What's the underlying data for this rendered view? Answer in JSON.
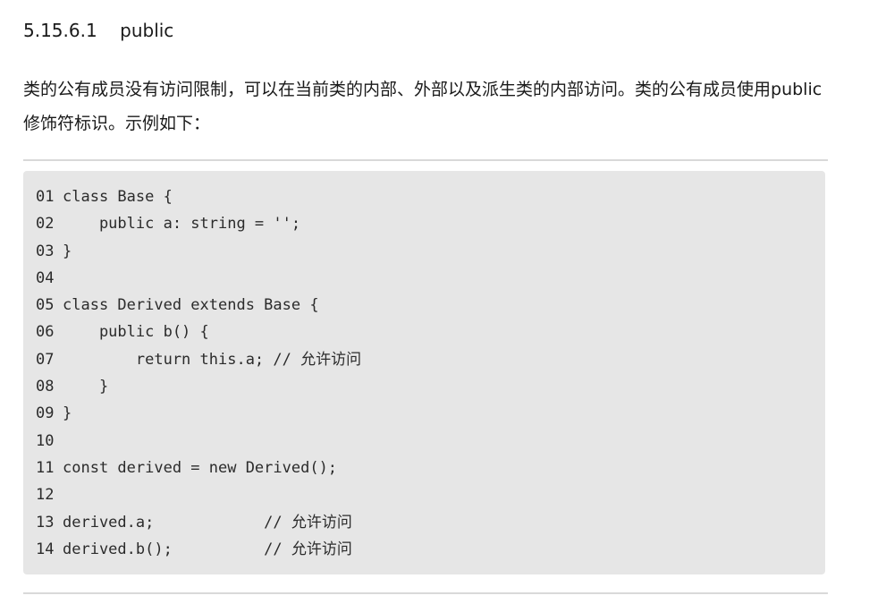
{
  "heading": "5.15.6.1    public",
  "paragraph": "类的公有成员没有访问限制，可以在当前类的内部、外部以及派生类的内部访问。类的公有成员使用public修饰符标识。示例如下：",
  "code": {
    "lines": [
      {
        "num": "01",
        "text": "class Base {"
      },
      {
        "num": "02",
        "text": "    public a: string = '';"
      },
      {
        "num": "03",
        "text": "}"
      },
      {
        "num": "04",
        "text": ""
      },
      {
        "num": "05",
        "text": "class Derived extends Base {"
      },
      {
        "num": "06",
        "text": "    public b() {"
      },
      {
        "num": "07",
        "text": "        return this.a; // 允许访问"
      },
      {
        "num": "08",
        "text": "    }"
      },
      {
        "num": "09",
        "text": "}"
      },
      {
        "num": "10",
        "text": ""
      },
      {
        "num": "11",
        "text": "const derived = new Derived();"
      },
      {
        "num": "12",
        "text": ""
      },
      {
        "num": "13",
        "text": "derived.a;            // 允许访问"
      },
      {
        "num": "14",
        "text": "derived.b();          // 允许访问"
      }
    ]
  }
}
